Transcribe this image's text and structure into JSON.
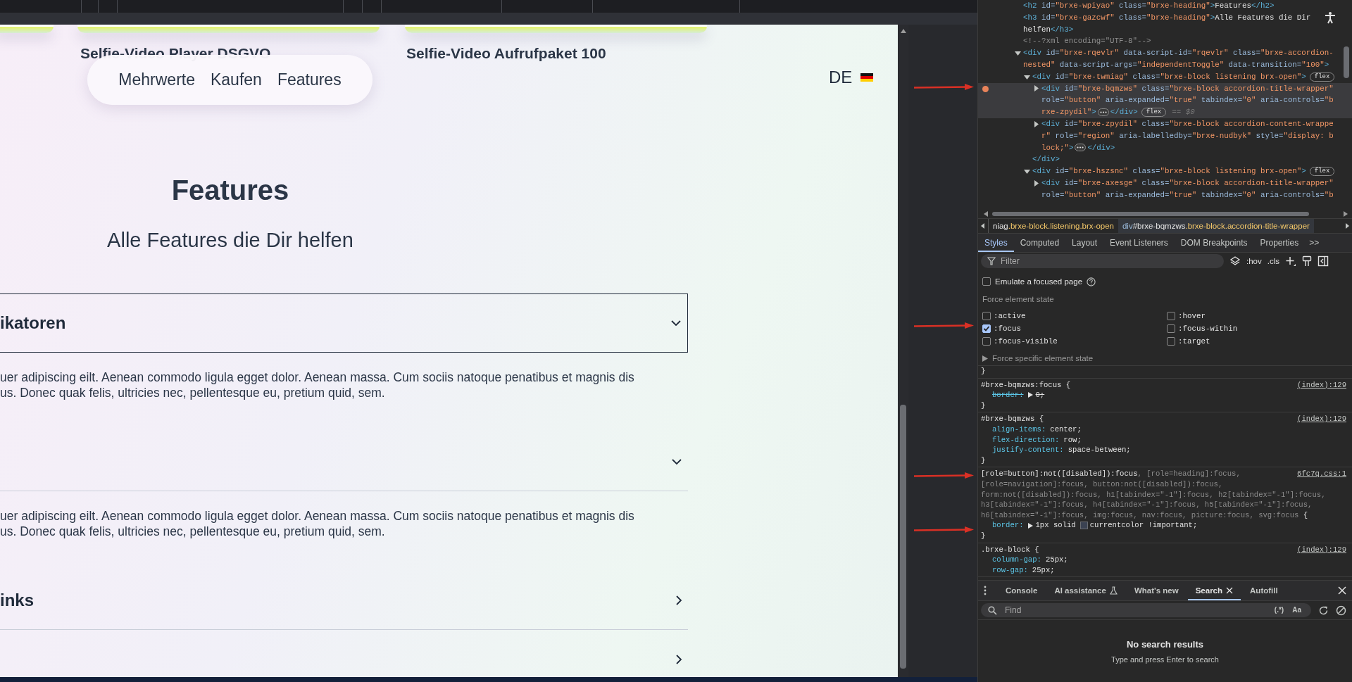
{
  "page": {
    "cards": [
      {
        "title": "Selfie-Video Player DSGVO"
      },
      {
        "title": "Selfie-Video Aufrufpaket 100"
      }
    ],
    "nav": {
      "links": [
        "Mehrwerte",
        "Kaufen",
        "Features"
      ]
    },
    "language": {
      "code": "DE"
    },
    "hero": {
      "heading": "Features",
      "subheading": "Alle Features die Dir helfen"
    },
    "accordion": [
      {
        "title": "ikatoren",
        "expanded": true,
        "focused": true,
        "body": [
          "uer adipiscing eilt. Aenean commodo ligula egget dolor. Aenean massa. Cum sociis natoque penatibus et magnis dis",
          "us. Donec quak felis, ultricies nec, pellentesque eu, pretium quid, sem."
        ]
      },
      {
        "expanded": true,
        "focused": false,
        "body": [
          "uer adipiscing eilt. Aenean commodo ligula egget dolor. Aenean massa. Cum sociis natoque penatibus et magnis dis",
          "us. Donec quak felis, ultricies nec, pellentesque eu, pretium quid, sem."
        ]
      },
      {
        "title": "inks",
        "expanded": false,
        "focused": false
      },
      {
        "expanded": false,
        "focused": false
      }
    ]
  },
  "elements": {
    "nodes": [
      {
        "selected": false,
        "marked": false,
        "lines": [
          [
            {
              "kind": "tag",
              "text": "<h2"
            },
            {
              "kind": "attr",
              "text": " id="
            },
            {
              "kind": "val",
              "text": "\"brxe-wpiyao\""
            },
            {
              "kind": "attr",
              "text": " class="
            },
            {
              "kind": "val",
              "text": "\"brxe-heading\""
            },
            {
              "kind": "tag",
              "text": ">"
            },
            {
              "kind": "text",
              "text": "Features"
            },
            {
              "kind": "tag",
              "text": "</h2>"
            }
          ]
        ]
      },
      {
        "selected": false,
        "marked": false,
        "lines": [
          [
            {
              "kind": "tag",
              "text": "<h3"
            },
            {
              "kind": "attr",
              "text": " id="
            },
            {
              "kind": "val",
              "text": "\"brxe-gazcwf\""
            },
            {
              "kind": "attr",
              "text": " class="
            },
            {
              "kind": "val",
              "text": "\"brxe-heading\""
            },
            {
              "kind": "tag",
              "text": ">"
            },
            {
              "kind": "text",
              "text": "Alle Features die Dir"
            }
          ],
          [
            {
              "kind": "text",
              "text": "helfen"
            },
            {
              "kind": "tag",
              "text": "</h3>"
            }
          ]
        ]
      },
      {
        "selected": false,
        "marked": false,
        "lines": [
          [
            {
              "kind": "comment",
              "text": "<!--?xml encoding=\"UTF-8\"-->"
            }
          ]
        ]
      },
      {
        "selected": false,
        "marked": false,
        "expanded": true,
        "lines": [
          [
            {
              "kind": "tag",
              "text": "<div"
            },
            {
              "kind": "attr",
              "text": " id="
            },
            {
              "kind": "val",
              "text": "\"brxe-rqevlr\""
            },
            {
              "kind": "attr",
              "text": " data-script-id="
            },
            {
              "kind": "val",
              "text": "\"rqevlr\""
            },
            {
              "kind": "attr",
              "text": " class="
            },
            {
              "kind": "val",
              "text": "\"brxe-accordion-"
            }
          ],
          [
            {
              "kind": "val",
              "text": "nested\""
            },
            {
              "kind": "attr",
              "text": " data-script-args="
            },
            {
              "kind": "val",
              "text": "\"independentToggle\""
            },
            {
              "kind": "attr",
              "text": " data-transition="
            },
            {
              "kind": "val",
              "text": "\"100\""
            },
            {
              "kind": "tag",
              "text": ">"
            }
          ]
        ],
        "children": [
          {
            "selected": false,
            "marked": false,
            "expanded": true,
            "lines": [
              [
                {
                  "kind": "tag",
                  "text": "<div"
                },
                {
                  "kind": "attr",
                  "text": " id="
                },
                {
                  "kind": "val",
                  "text": "\"brxe-twmiag\""
                },
                {
                  "kind": "attr",
                  "text": " class="
                },
                {
                  "kind": "val",
                  "text": "\"brxe-block listening brx-open\""
                },
                {
                  "kind": "tag",
                  "text": ">"
                },
                {
                  "kind": "badge",
                  "text": "flex"
                }
              ]
            ],
            "children": [
              {
                "selected": true,
                "marked": true,
                "expanded": false,
                "lines": [
                  [
                    {
                      "kind": "tag",
                      "text": "<div"
                    },
                    {
                      "kind": "attr",
                      "text": " id="
                    },
                    {
                      "kind": "val",
                      "text": "\"brxe-bqmzws\""
                    },
                    {
                      "kind": "attr",
                      "text": " class="
                    },
                    {
                      "kind": "val",
                      "text": "\"brxe-block accordion-title-wrapper\""
                    }
                  ],
                  [
                    {
                      "kind": "attr",
                      "text": "role="
                    },
                    {
                      "kind": "val",
                      "text": "\"button\""
                    },
                    {
                      "kind": "attr",
                      "text": " aria-expanded="
                    },
                    {
                      "kind": "val",
                      "text": "\"true\""
                    },
                    {
                      "kind": "attr",
                      "text": " tabindex="
                    },
                    {
                      "kind": "val",
                      "text": "\"0\""
                    },
                    {
                      "kind": "attr",
                      "text": " aria-controls="
                    },
                    {
                      "kind": "val",
                      "text": "\"b"
                    }
                  ],
                  [
                    {
                      "kind": "val",
                      "text": "rxe-zpydil\""
                    },
                    {
                      "kind": "tag",
                      "text": ">"
                    },
                    {
                      "kind": "ellipsis"
                    },
                    {
                      "kind": "tag",
                      "text": "</div>"
                    },
                    {
                      "kind": "badge",
                      "text": "flex"
                    },
                    {
                      "kind": "hint",
                      "text": "== $0"
                    }
                  ]
                ]
              },
              {
                "selected": false,
                "marked": false,
                "expanded": false,
                "lines": [
                  [
                    {
                      "kind": "tag",
                      "text": "<div"
                    },
                    {
                      "kind": "attr",
                      "text": " id="
                    },
                    {
                      "kind": "val",
                      "text": "\"brxe-zpydil\""
                    },
                    {
                      "kind": "attr",
                      "text": " class="
                    },
                    {
                      "kind": "val",
                      "text": "\"brxe-block accordion-content-wrappe"
                    }
                  ],
                  [
                    {
                      "kind": "val",
                      "text": "r\""
                    },
                    {
                      "kind": "attr",
                      "text": " role="
                    },
                    {
                      "kind": "val",
                      "text": "\"region\""
                    },
                    {
                      "kind": "attr",
                      "text": " aria-labelledby="
                    },
                    {
                      "kind": "val",
                      "text": "\"brxe-nudbyk\""
                    },
                    {
                      "kind": "attr",
                      "text": " style="
                    },
                    {
                      "kind": "val",
                      "text": "\"display: b"
                    }
                  ],
                  [
                    {
                      "kind": "val",
                      "text": "lock;\""
                    },
                    {
                      "kind": "tag",
                      "text": ">"
                    },
                    {
                      "kind": "ellipsis"
                    },
                    {
                      "kind": "tag",
                      "text": "</div>"
                    }
                  ]
                ]
              }
            ]
          },
          {
            "selected": false,
            "marked": false,
            "lines": [
              [
                {
                  "kind": "tag",
                  "text": "</div>"
                }
              ]
            ]
          },
          {
            "selected": false,
            "marked": false,
            "expanded": true,
            "lines": [
              [
                {
                  "kind": "tag",
                  "text": "<div"
                },
                {
                  "kind": "attr",
                  "text": " id="
                },
                {
                  "kind": "val",
                  "text": "\"brxe-hszsnc\""
                },
                {
                  "kind": "attr",
                  "text": " class="
                },
                {
                  "kind": "val",
                  "text": "\"brxe-block listening brx-open\""
                },
                {
                  "kind": "tag",
                  "text": ">"
                },
                {
                  "kind": "badge",
                  "text": "flex"
                }
              ]
            ],
            "children": [
              {
                "selected": false,
                "marked": false,
                "expanded": false,
                "lines": [
                  [
                    {
                      "kind": "tag",
                      "text": "<div"
                    },
                    {
                      "kind": "attr",
                      "text": " id="
                    },
                    {
                      "kind": "val",
                      "text": "\"brxe-axesge\""
                    },
                    {
                      "kind": "attr",
                      "text": " class="
                    },
                    {
                      "kind": "val",
                      "text": "\"brxe-block accordion-title-wrapper\""
                    }
                  ],
                  [
                    {
                      "kind": "attr",
                      "text": "role="
                    },
                    {
                      "kind": "val",
                      "text": "\"button\""
                    },
                    {
                      "kind": "attr",
                      "text": " aria-expanded="
                    },
                    {
                      "kind": "val",
                      "text": "\"true\""
                    },
                    {
                      "kind": "attr",
                      "text": " tabindex="
                    },
                    {
                      "kind": "val",
                      "text": "\"0\""
                    },
                    {
                      "kind": "attr",
                      "text": " aria-controls="
                    },
                    {
                      "kind": "val",
                      "text": "\"b"
                    }
                  ]
                ]
              }
            ]
          }
        ]
      }
    ]
  },
  "breadcrumb": [
    {
      "selected": false,
      "parts": [
        {
          "kind": "id",
          "text": "niag"
        },
        {
          "kind": "class",
          "text": ".brxe-block.listening.brx-open"
        }
      ]
    },
    {
      "selected": true,
      "parts": [
        {
          "kind": "tag",
          "text": "div"
        },
        {
          "kind": "id",
          "text": "#brxe-bqmzws"
        },
        {
          "kind": "class",
          "text": ".brxe-block.accordion-title-wrapper"
        }
      ]
    }
  ],
  "styles_tabs": [
    {
      "label": "Styles",
      "selected": true
    },
    {
      "label": "Computed",
      "selected": false
    },
    {
      "label": "Layout",
      "selected": false
    },
    {
      "label": "Event Listeners",
      "selected": false
    },
    {
      "label": "DOM Breakpoints",
      "selected": false
    },
    {
      "label": "Properties",
      "selected": false
    }
  ],
  "more_tabs": ">>",
  "filter": {
    "placeholder": "Filter",
    "hov": ":hov",
    "cls": ".cls"
  },
  "emulate_focus": {
    "label": "Emulate a focused page",
    "checked": false
  },
  "force_state": {
    "title": "Force element state",
    "states": [
      {
        "label": ":active",
        "checked": false
      },
      {
        "label": ":hover",
        "checked": false
      },
      {
        "label": ":focus",
        "checked": true
      },
      {
        "label": ":focus-within",
        "checked": false
      },
      {
        "label": ":focus-visible",
        "checked": false
      },
      {
        "label": ":target",
        "checked": false
      }
    ],
    "specific": "Force specific element state"
  },
  "rules": [
    {
      "close": "}"
    },
    {
      "selector": [
        [
          {
            "text": "#brxe-bqmzws:focus {",
            "matched": true
          }
        ]
      ],
      "source": "(index):129",
      "declarations": [
        {
          "property": "border:",
          "value": "0;",
          "struck": true,
          "expandable": true
        }
      ],
      "close": "}"
    },
    {
      "selector": [
        [
          {
            "text": "#brxe-bqmzws {",
            "matched": true
          }
        ]
      ],
      "source": "(index):129",
      "declarations": [
        {
          "property": "align-items:",
          "value": "center;",
          "struck": false,
          "expandable": false
        },
        {
          "property": "flex-direction:",
          "value": "row;",
          "struck": false,
          "expandable": false
        },
        {
          "property": "justify-content:",
          "value": "space-between;",
          "struck": false,
          "expandable": false
        }
      ],
      "close": "}"
    },
    {
      "selector": [
        [
          {
            "text": "[role=button]:not([disabled]):focus",
            "matched": true
          },
          {
            "text": ", [role=heading]:focus,",
            "matched": false
          }
        ],
        [
          {
            "text": "[role=navigation]:focus, button:not([disabled]):focus,",
            "matched": false
          }
        ],
        [
          {
            "text": "form:not([disabled]):focus, h1[tabindex=\"-1\"]:focus, h2[tabindex=\"-1\"]:focus,",
            "matched": false
          }
        ],
        [
          {
            "text": "h3[tabindex=\"-1\"]:focus, h4[tabindex=\"-1\"]:focus, h5[tabindex=\"-1\"]:focus,",
            "matched": false
          }
        ],
        [
          {
            "text": "h6[tabindex=\"-1\"]:focus, img:focus, nav:focus, picture:focus, svg:focus",
            "matched": false
          },
          {
            "text": " {",
            "matched": true
          }
        ]
      ],
      "source": "6fc7q.css:1",
      "declarations": [
        {
          "property": "border:",
          "value": "1px solid",
          "swatch": true,
          "value_after": "currentcolor !important;",
          "struck": false,
          "expandable": true
        }
      ],
      "close": "}"
    },
    {
      "selector": [
        [
          {
            "text": ".brxe-block {",
            "matched": true
          }
        ]
      ],
      "source": "(index):129",
      "declarations": [
        {
          "property": "column-gap:",
          "value": "25px;",
          "struck": false,
          "expandable": false
        },
        {
          "property": "row-gap:",
          "value": "25px;",
          "struck": false,
          "expandable": false
        }
      ]
    }
  ],
  "drawer_tabs": [
    {
      "label": "Console",
      "selected": false
    },
    {
      "label": "AI assistance",
      "selected": false,
      "kind": "experiment"
    },
    {
      "label": "What's new",
      "selected": false
    },
    {
      "label": "Search",
      "selected": true,
      "kind": "closable"
    },
    {
      "label": "Autofill",
      "selected": false
    }
  ],
  "search": {
    "placeholder": "Find",
    "regex": "(.*)",
    "case": "Aa",
    "empty_title": "No search results",
    "empty_hint": "Type and press Enter to search"
  }
}
